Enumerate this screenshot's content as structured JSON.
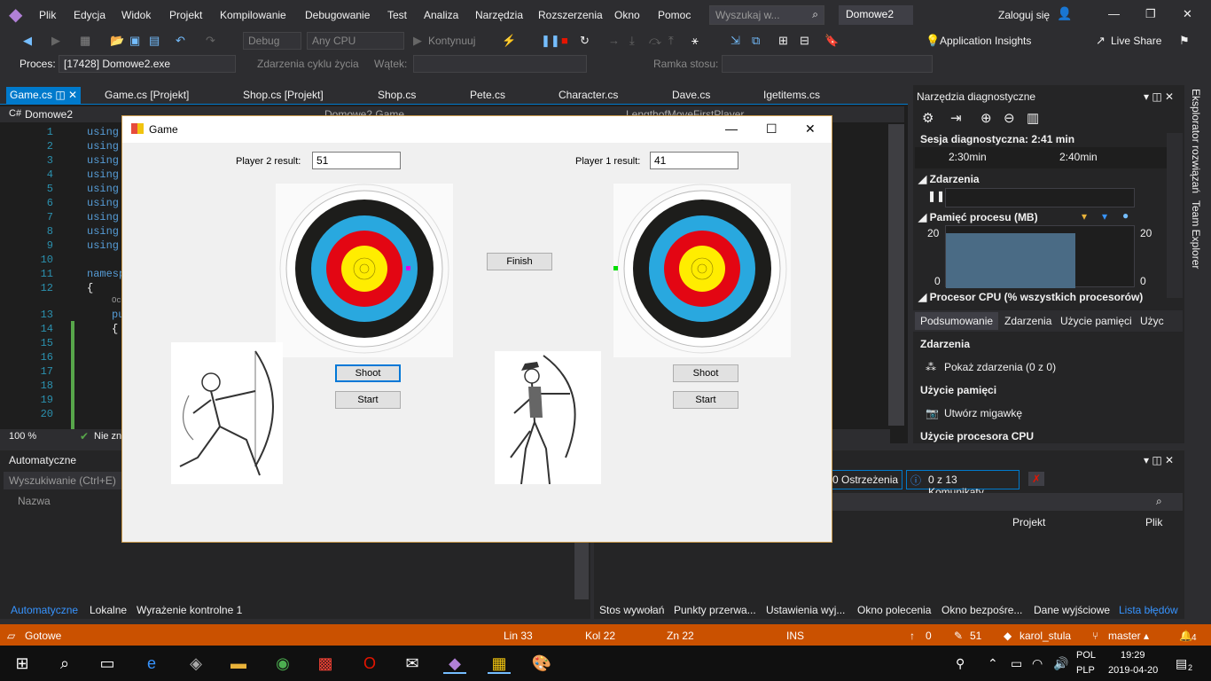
{
  "menubar": {
    "items": [
      "Plik",
      "Edycja",
      "Widok",
      "Projekt",
      "Kompilowanie",
      "Debugowanie",
      "Test",
      "Analiza",
      "Narzędzia",
      "Rozszerzenia",
      "Okno",
      "Pomoc"
    ],
    "search_placeholder": "Wyszukaj w...",
    "solution": "Domowe2",
    "login": "Zaloguj się"
  },
  "toolbar": {
    "config": "Debug",
    "platform": "Any CPU",
    "continue": "Kontynuuj",
    "app_insights": "Application Insights",
    "live_share": "Live Share"
  },
  "toolbar2": {
    "process_label": "Proces:",
    "process_value": "[17428] Domowe2.exe",
    "lifecycle": "Zdarzenia cyklu życia",
    "thread": "Wątek:",
    "stack": "Ramka stosu:"
  },
  "tabs": [
    "Game.cs",
    "Game.cs [Projekt]",
    "Shop.cs [Projekt]",
    "Shop.cs",
    "Pete.cs",
    "Character.cs",
    "Dave.cs",
    "Igetitems.cs"
  ],
  "editor": {
    "project": "Domowe2",
    "nav_class": "Domowe2.Game",
    "nav_member": "LengthofMoveFirstPlayer",
    "line_numbers": [
      "1",
      "2",
      "3",
      "4",
      "5",
      "6",
      "7",
      "8",
      "9",
      "10",
      "11",
      "12",
      "",
      "13",
      "14",
      "15",
      "16",
      "17",
      "18",
      "19",
      "20"
    ],
    "lines": [
      "using",
      "using",
      "using",
      "using",
      "using",
      "using",
      "using",
      "using",
      "using",
      "",
      "namesp",
      "{",
      "Oc",
      "pu",
      "{",
      "",
      "",
      "",
      "",
      "",
      ""
    ],
    "zoom": "100 %",
    "issues": "Nie zn"
  },
  "diag": {
    "title": "Narzędzia diagnostyczne",
    "session": "Sesja diagnostyczna: 2:41 min",
    "t1": "2:30min",
    "t2": "2:40min",
    "events": "Zdarzenia",
    "memory": "Pamięć procesu (MB)",
    "mem_max": "20",
    "mem_min": "0",
    "cpu": "Procesor CPU (% wszystkich procesorów)",
    "subtabs": [
      "Podsumowanie",
      "Zdarzenia",
      "Użycie pamięci",
      "Użyc"
    ],
    "sec_events": "Zdarzenia",
    "show_events": "Pokaż zdarzenia (0 z 0)",
    "sec_memory": "Użycie pamięci",
    "snapshot": "Utwórz migawkę",
    "sec_cpu": "Użycie procesora CPU"
  },
  "side": {
    "explorer": "Eksplorator rozwiązań",
    "team": "Team Explorer"
  },
  "autos": {
    "title": "Automatyczne",
    "search": "Wyszukiwanie (Ctrl+E)",
    "col_name": "Nazwa",
    "tabs": [
      "Automatyczne",
      "Lokalne",
      "Wyrażenie kontrolne 1"
    ]
  },
  "errors": {
    "warnings": "0 Ostrzeżenia",
    "messages": "0 z 13 Komunikaty",
    "col_project": "Projekt",
    "col_file": "Plik",
    "tabs": [
      "Stos wywołań",
      "Punkty przerwa...",
      "Ustawienia wyj...",
      "Okno polecenia",
      "Okno bezpośre...",
      "Dane wyjściowe",
      "Lista błędów"
    ]
  },
  "status": {
    "ready": "Gotowe",
    "line": "Lin 33",
    "col": "Kol 22",
    "ch": "Zn 22",
    "ins": "INS",
    "up": "0",
    "edits": "51",
    "user": "karol_stula",
    "branch": "master",
    "notif": "4"
  },
  "taskbar": {
    "lang1": "POL",
    "lang2": "PLP",
    "time": "19:29",
    "date": "2019-04-20",
    "notif": "2"
  },
  "game": {
    "title": "Game",
    "p2_label": "Player 2 result:",
    "p2_value": "51",
    "p1_label": "Player 1 result:",
    "p1_value": "41",
    "finish": "Finish",
    "shoot": "Shoot",
    "start": "Start"
  }
}
